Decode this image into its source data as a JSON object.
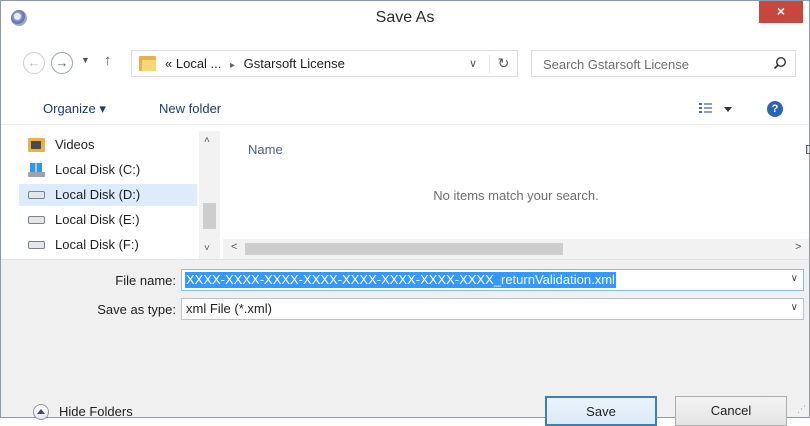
{
  "window": {
    "title": "Save As",
    "close_label": "×"
  },
  "address": {
    "back_glyph": "←",
    "forward_glyph": "→",
    "recent_glyph": "▼",
    "up_glyph": "↑",
    "overflow": "«",
    "crumbs": [
      "Local ...",
      "Gstarsoft License"
    ],
    "crumb_separator": "▸",
    "dropdown_glyph": "∨",
    "refresh_glyph": "↻",
    "search_placeholder": "Search Gstarsoft License"
  },
  "toolbar": {
    "organize_label": "Organize ▾",
    "new_folder_label": "New folder",
    "help_label": "?"
  },
  "navigation": {
    "items": [
      {
        "label": "Videos",
        "icon": "videos-library-icon",
        "selected": false
      },
      {
        "label": "Local Disk (C:)",
        "icon": "system-disk-icon",
        "selected": false
      },
      {
        "label": "Local Disk (D:)",
        "icon": "disk-drive-icon",
        "selected": true
      },
      {
        "label": "Local Disk (E:)",
        "icon": "disk-drive-icon",
        "selected": false
      },
      {
        "label": "Local Disk (F:)",
        "icon": "disk-drive-icon",
        "selected": false
      }
    ],
    "scroll_up": "˄",
    "scroll_down": "˅"
  },
  "file_list": {
    "column_name": "Name",
    "column_edge": "D",
    "empty_message": "No items match your search.",
    "scroll_left": "<",
    "scroll_right": ">"
  },
  "save_form": {
    "file_name_label": "File name:",
    "file_name_value": "XXXX-XXXX-XXXX-XXXX-XXXX-XXXX-XXXX-XXXX_returnValidation.xml",
    "save_type_label": "Save as type:",
    "save_type_value": "xml File (*.xml)",
    "dropdown_glyph": "∨"
  },
  "footer": {
    "hide_folders_label": "Hide Folders",
    "save_label": "Save",
    "cancel_label": "Cancel",
    "grip": "⋰"
  }
}
